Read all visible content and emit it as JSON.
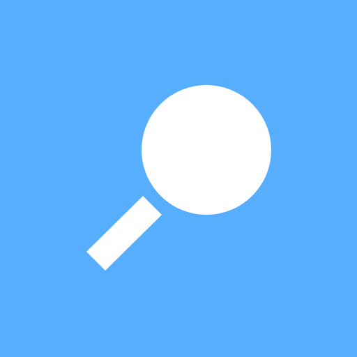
{
  "app_icon": {
    "icon": "magnifying-glass-icon",
    "colors": {
      "background": "#56aefc",
      "glyph": "#ffffff"
    }
  }
}
